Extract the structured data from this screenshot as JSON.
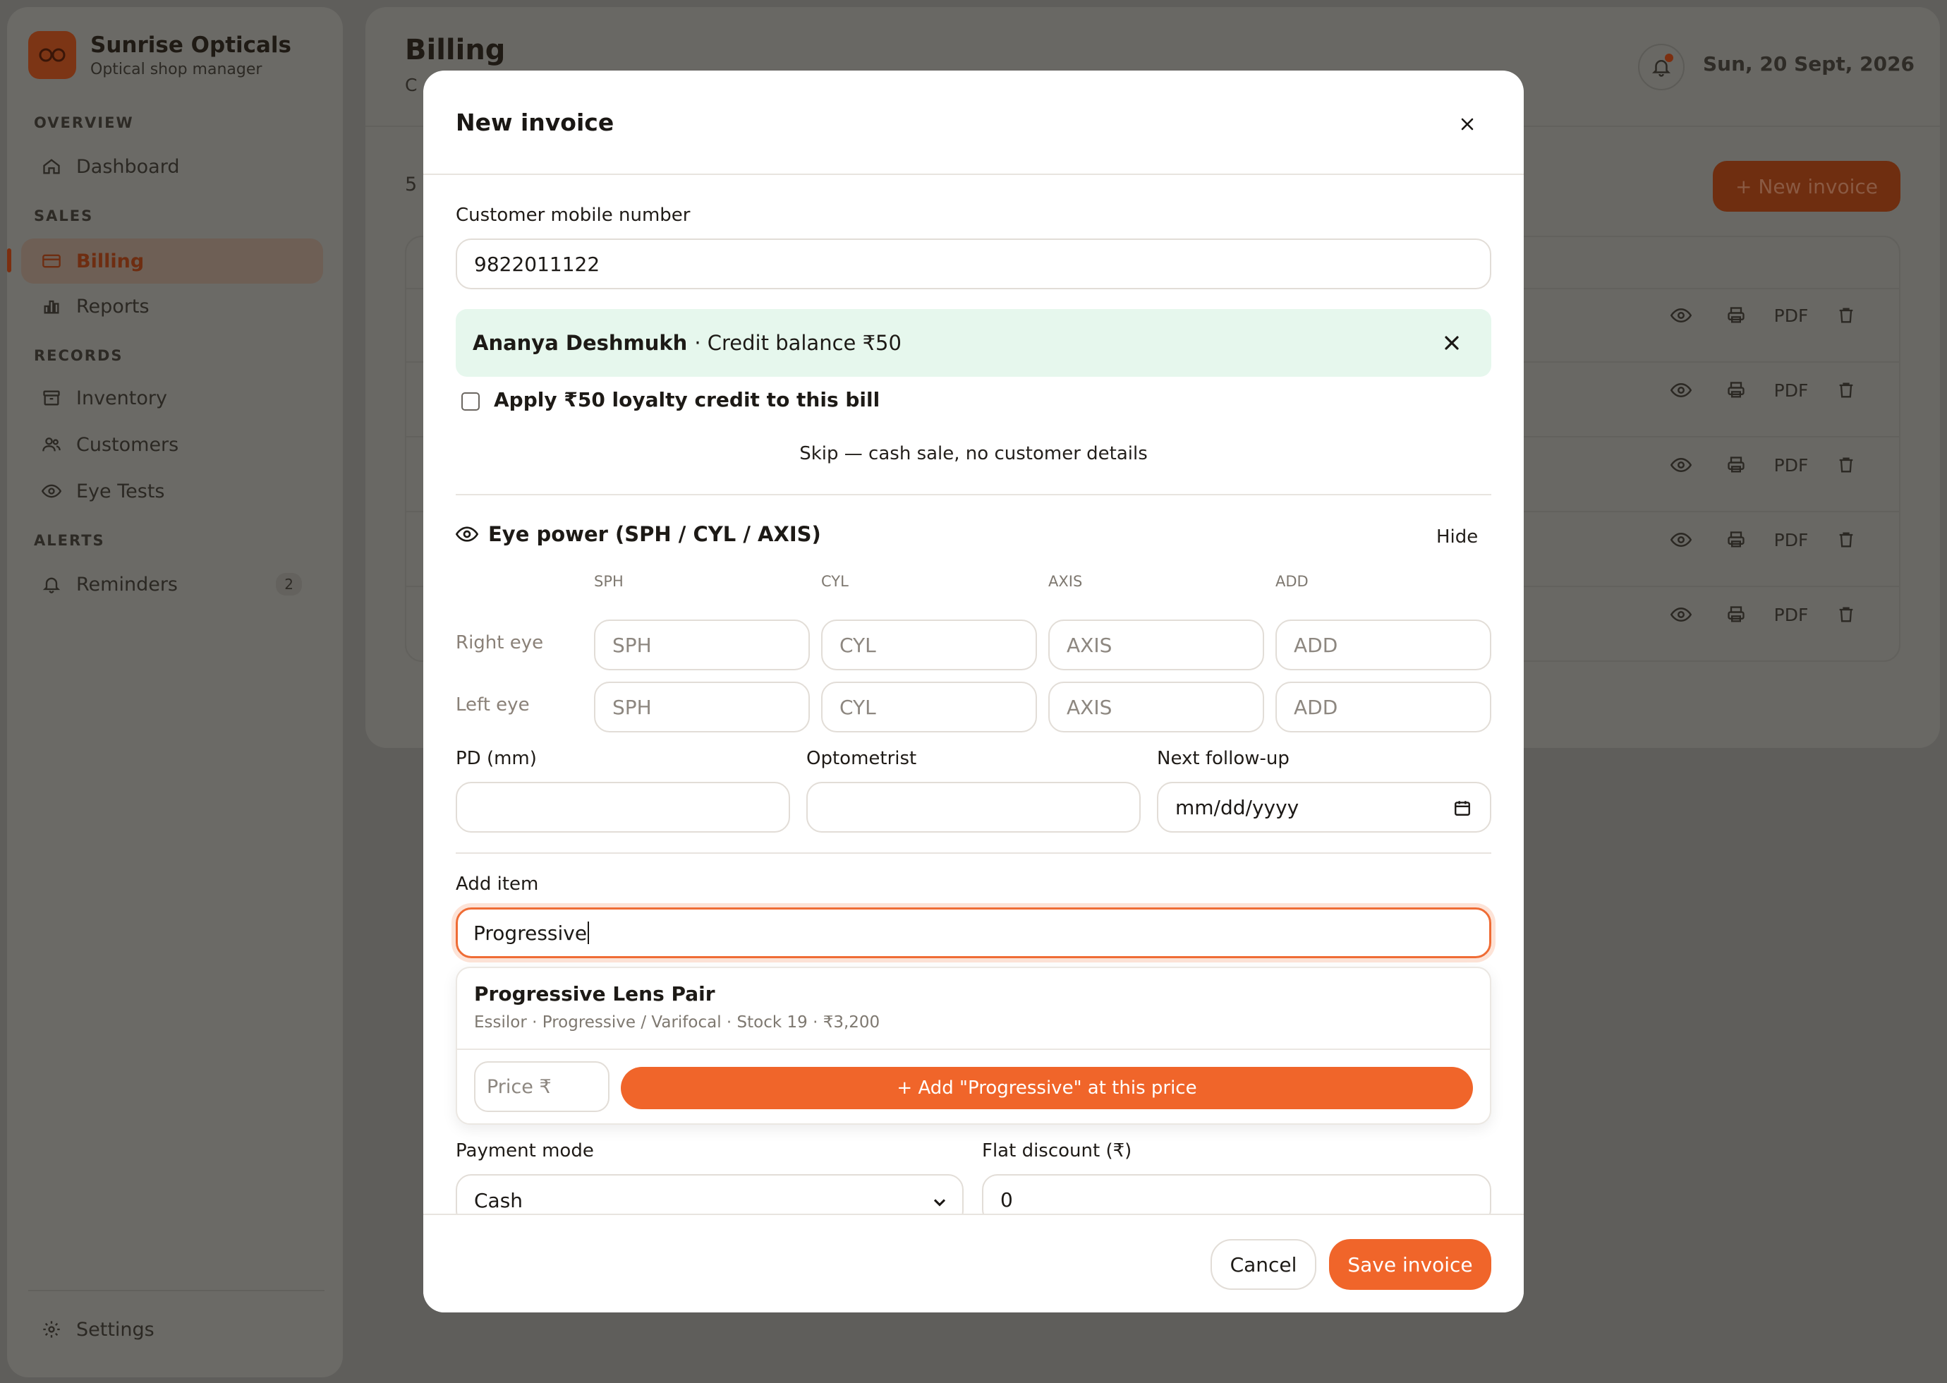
{
  "brand": {
    "name": "Sunrise Opticals",
    "subtitle": "Optical shop manager"
  },
  "sidebar": {
    "sections": {
      "overview": "OVERVIEW",
      "sales": "SALES",
      "records": "RECORDS",
      "alerts": "ALERTS"
    },
    "items": {
      "dashboard": "Dashboard",
      "billing": "Billing",
      "reports": "Reports",
      "inventory": "Inventory",
      "customers": "Customers",
      "eye_tests": "Eye Tests",
      "reminders": "Reminders",
      "reminders_badge": "2",
      "settings": "Settings"
    }
  },
  "header": {
    "title": "Billing",
    "subtitle_partial": "C",
    "date": "Sun, 20 Sept, 2026",
    "notification_dot_color": "#e8632a"
  },
  "content": {
    "count_partial": "5",
    "new_invoice_label": "+ New invoice",
    "row_pdf_label": "PDF",
    "rows": 5
  },
  "modal": {
    "title": "New invoice",
    "customer": {
      "label": "Customer mobile number",
      "value": "9822011122",
      "name": "Ananya Deshmukh",
      "credit": "· Credit balance ₹50",
      "apply_credit_label": "Apply ₹50 loyalty credit to this bill",
      "skip_label": "Skip — cash sale, no customer details"
    },
    "eye_power": {
      "title": "Eye power (SPH / CYL / AXIS)",
      "hide_label": "Hide",
      "columns": [
        "SPH",
        "CYL",
        "AXIS",
        "ADD"
      ],
      "right_label": "Right eye",
      "left_label": "Left eye",
      "placeholders": [
        "SPH",
        "CYL",
        "AXIS",
        "ADD"
      ]
    },
    "pd_label": "PD (mm)",
    "optometrist_label": "Optometrist",
    "followup_label": "Next follow-up",
    "followup_placeholder": "mm/dd/yyyy",
    "add_item": {
      "label": "Add item",
      "value": "Progressive",
      "result_title": "Progressive Lens Pair",
      "result_sub": "Essilor · Progressive / Varifocal · Stock 19 · ₹3,200",
      "price_placeholder": "Price ₹",
      "add_button": "+  Add \"Progressive\" at this price"
    },
    "payment_label": "Payment mode",
    "payment_value": "Cash",
    "discount_label": "Flat discount (₹)",
    "discount_value": "0",
    "cancel_label": "Cancel",
    "save_label": "Save invoice"
  },
  "colors": {
    "accent": "#f0652a",
    "success_bg": "#e6f7ed",
    "overlay": "#5f5e5b"
  }
}
